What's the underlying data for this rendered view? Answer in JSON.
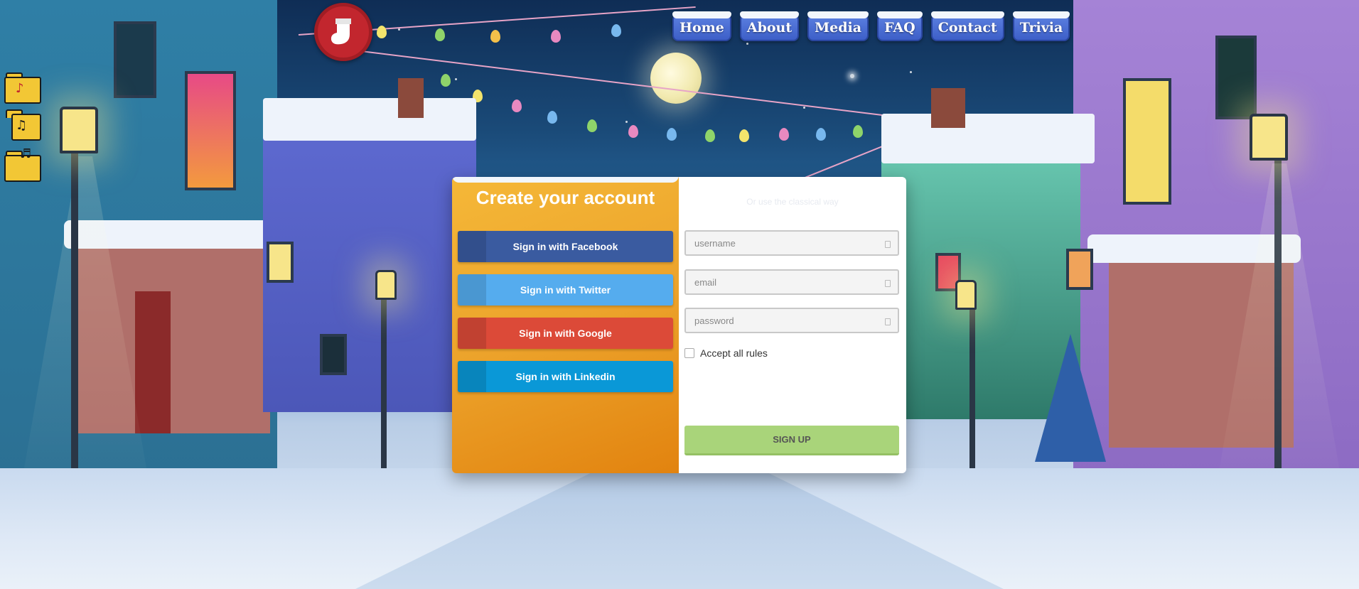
{
  "nav": {
    "items": [
      {
        "label": "Home"
      },
      {
        "label": "About"
      },
      {
        "label": "Media"
      },
      {
        "label": "FAQ"
      },
      {
        "label": "Contact"
      },
      {
        "label": "Trivia"
      }
    ]
  },
  "logo": {
    "icon": "christmas-stocking-icon"
  },
  "desktop_icons": [
    {
      "icon": "music-folder-icon"
    },
    {
      "icon": "music-note-icon"
    },
    {
      "icon": "music-folder-icon"
    }
  ],
  "signup": {
    "title": "Create your account",
    "social": {
      "facebook": "Sign in with Facebook",
      "twitter": "Sign in with Twitter",
      "google": "Sign in with Google",
      "linkedin": "Sign in with Linkedin"
    },
    "right_heading": "Or use the classical way",
    "username_placeholder": "username",
    "email_placeholder": "email",
    "password_placeholder": "password",
    "accept_label": "Accept all rules",
    "submit_label": "SIGN UP"
  },
  "colors": {
    "facebook": "#3a5ba0",
    "twitter": "#55acee",
    "google": "#dc4a38",
    "linkedin": "#0a98d7",
    "signup": "#a9d47a",
    "card_left": "#eca32b"
  }
}
